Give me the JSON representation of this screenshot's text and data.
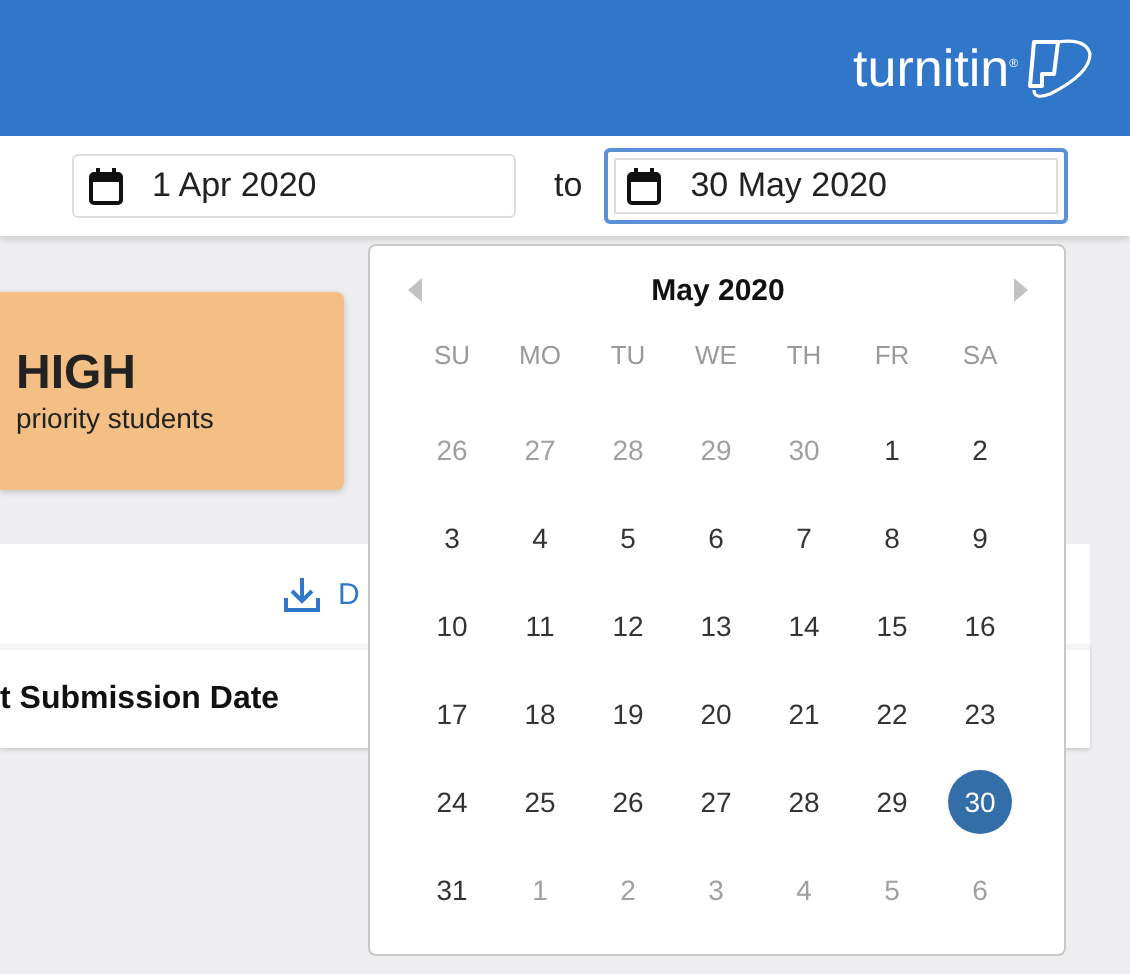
{
  "header": {
    "logo": "turnitin$^{®}$"
  },
  "date_range": {
    "from": {
      "value": "1 Apr 2020",
      "focused": false
    },
    "separator": "to",
    "to": {
      "value": "30 May 2020",
      "focused": true
    }
  },
  "priority_card": {
    "level": "HIGH",
    "caption": "priority students"
  },
  "panel": {
    "action": "D",
    "column_header": "t Submission Date"
  },
  "calendar": {
    "title": "May 2020",
    "weekdays": [
      "SU",
      "MO",
      "TU",
      "WE",
      "TH",
      "FR",
      "SA"
    ],
    "weeks": [
      [
        {
          "label": "26",
          "outside": true,
          "selected": false
        },
        {
          "label": "27",
          "outside": true,
          "selected": false
        },
        {
          "label": "28",
          "outside": true,
          "selected": false
        },
        {
          "label": "29",
          "outside": true,
          "selected": false
        },
        {
          "label": "30",
          "outside": true,
          "selected": false
        },
        {
          "label": "1",
          "outside": false,
          "selected": false
        },
        {
          "label": "2",
          "outside": false,
          "selected": false
        }
      ],
      [
        {
          "label": "3",
          "outside": false,
          "selected": false
        },
        {
          "label": "4",
          "outside": false,
          "selected": false
        },
        {
          "label": "5",
          "outside": false,
          "selected": false
        },
        {
          "label": "6",
          "outside": false,
          "selected": false
        },
        {
          "label": "7",
          "outside": false,
          "selected": false
        },
        {
          "label": "8",
          "outside": false,
          "selected": false
        },
        {
          "label": "9",
          "outside": false,
          "selected": false
        }
      ],
      [
        {
          "label": "10",
          "outside": false,
          "selected": false
        },
        {
          "label": "11",
          "outside": false,
          "selected": false
        },
        {
          "label": "12",
          "outside": false,
          "selected": false
        },
        {
          "label": "13",
          "outside": false,
          "selected": false
        },
        {
          "label": "14",
          "outside": false,
          "selected": false
        },
        {
          "label": "15",
          "outside": false,
          "selected": false
        },
        {
          "label": "16",
          "outside": false,
          "selected": false
        }
      ],
      [
        {
          "label": "17",
          "outside": false,
          "selected": false
        },
        {
          "label": "18",
          "outside": false,
          "selected": false
        },
        {
          "label": "19",
          "outside": false,
          "selected": false
        },
        {
          "label": "20",
          "outside": false,
          "selected": false
        },
        {
          "label": "21",
          "outside": false,
          "selected": false
        },
        {
          "label": "22",
          "outside": false,
          "selected": false
        },
        {
          "label": "23",
          "outside": false,
          "selected": false
        }
      ],
      [
        {
          "label": "24",
          "outside": false,
          "selected": false
        },
        {
          "label": "25",
          "outside": false,
          "selected": false
        },
        {
          "label": "26",
          "outside": false,
          "selected": false
        },
        {
          "label": "27",
          "outside": false,
          "selected": false
        },
        {
          "label": "28",
          "outside": false,
          "selected": false
        },
        {
          "label": "29",
          "outside": false,
          "selected": false
        },
        {
          "label": "30",
          "outside": false,
          "selected": true
        }
      ],
      [
        {
          "label": "31",
          "outside": false,
          "selected": false
        },
        {
          "label": "1",
          "outside": true,
          "selected": false
        },
        {
          "label": "2",
          "outside": true,
          "selected": false
        },
        {
          "label": "3",
          "outside": true,
          "selected": false
        },
        {
          "label": "4",
          "outside": true,
          "selected": false
        },
        {
          "label": "5",
          "outside": true,
          "selected": false
        },
        {
          "label": "6",
          "outside": true,
          "selected": false
        }
      ]
    ]
  }
}
